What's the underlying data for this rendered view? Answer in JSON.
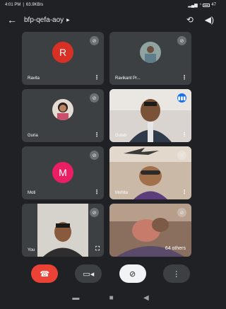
{
  "status_bar": {
    "time": "4:01 PM",
    "network_speed": "63.9KB/s",
    "battery_level": "47"
  },
  "header": {
    "meeting_code": "bfp-qefa-aoy",
    "icons": [
      "back-arrow-icon",
      "chevron-right-icon",
      "switch-camera-icon",
      "speaker-icon"
    ]
  },
  "participants": [
    {
      "name": "Ravita",
      "type": "initial",
      "initial": "R",
      "color": "#d93025",
      "muted": true
    },
    {
      "name": "Ravikant Pr...",
      "type": "photo",
      "muted": true
    },
    {
      "name": "Guria",
      "type": "photo",
      "muted": true
    },
    {
      "name": "Gulab",
      "type": "video",
      "muted": false,
      "speaking": true
    },
    {
      "name": "Moti",
      "initial": "M",
      "type": "initial",
      "color": "#e91e63",
      "muted": true
    },
    {
      "name": "Mohita",
      "type": "video",
      "muted": true
    },
    {
      "name": "You",
      "type": "video",
      "muted": true
    },
    {
      "name": "",
      "type": "video",
      "muted": true,
      "overflow_label": "64 others"
    }
  ],
  "controls": [
    {
      "name": "end-call",
      "icon": "phone-hangup-icon",
      "color": "#ea4335"
    },
    {
      "name": "camera",
      "icon": "video-icon"
    },
    {
      "name": "microphone",
      "icon": "mic-off-icon"
    },
    {
      "name": "more",
      "icon": "more-vert-icon"
    }
  ],
  "nav": {
    "icons": [
      "recents-icon",
      "home-icon",
      "back-icon"
    ]
  }
}
